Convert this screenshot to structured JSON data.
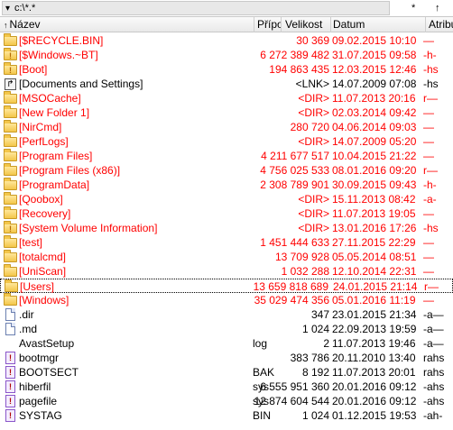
{
  "path_bar": {
    "drive_glyph": "▾",
    "path": "c:\\*.*",
    "star": "*",
    "updir": "↑"
  },
  "header": {
    "name": "Název",
    "ext": "Přípona",
    "size": "Velikost",
    "date": "Datum",
    "attr": "Atributy",
    "sort_arrow": "↑"
  },
  "colors": {
    "system": "#ff0000",
    "normal": "#000000",
    "folder": "#f3c64a"
  },
  "rows": [
    {
      "icon": "folder-icon",
      "name": "[$RECYCLE.BIN]",
      "ext": "",
      "size": "30 369",
      "date": "09.02.2015 10:10",
      "attr": "—",
      "red": true
    },
    {
      "icon": "folder-warning-icon",
      "name": "[$Windows.~BT]",
      "ext": "",
      "size": "6 272 389 482",
      "date": "31.07.2015 09:58",
      "attr": "-h-",
      "red": true
    },
    {
      "icon": "folder-warning-icon",
      "name": "[Boot]",
      "ext": "",
      "size": "194 863 435",
      "date": "12.03.2015 12:46",
      "attr": "-hs",
      "red": true
    },
    {
      "icon": "junction-icon",
      "name": "[Documents and Settings]",
      "ext": "",
      "size": "<LNK>",
      "date": "14.07.2009 07:08",
      "attr": "-hs",
      "red": false
    },
    {
      "icon": "folder-icon",
      "name": "[MSOCache]",
      "ext": "",
      "size": "<DIR>",
      "date": "11.07.2013 20:16",
      "attr": "r—",
      "red": true
    },
    {
      "icon": "folder-icon",
      "name": "[New Folder 1]",
      "ext": "",
      "size": "<DIR>",
      "date": "02.03.2014 09:42",
      "attr": "—",
      "red": true
    },
    {
      "icon": "folder-icon",
      "name": "[NirCmd]",
      "ext": "",
      "size": "280 720",
      "date": "04.06.2014 09:03",
      "attr": "—",
      "red": true
    },
    {
      "icon": "folder-icon",
      "name": "[PerfLogs]",
      "ext": "",
      "size": "<DIR>",
      "date": "14.07.2009 05:20",
      "attr": "—",
      "red": true
    },
    {
      "icon": "folder-icon",
      "name": "[Program Files]",
      "ext": "",
      "size": "4 211 677 517",
      "date": "10.04.2015 21:22",
      "attr": "—",
      "red": true
    },
    {
      "icon": "folder-icon",
      "name": "[Program Files (x86)]",
      "ext": "",
      "size": "4 756 025 533",
      "date": "08.01.2016 09:20",
      "attr": "r—",
      "red": true
    },
    {
      "icon": "folder-icon",
      "name": "[ProgramData]",
      "ext": "",
      "size": "2 308 789 901",
      "date": "30.09.2015 09:43",
      "attr": "-h-",
      "red": true
    },
    {
      "icon": "folder-icon",
      "name": "[Qoobox]",
      "ext": "",
      "size": "<DIR>",
      "date": "15.11.2013 08:42",
      "attr": "-a-",
      "red": true
    },
    {
      "icon": "folder-icon",
      "name": "[Recovery]",
      "ext": "",
      "size": "<DIR>",
      "date": "11.07.2013 19:05",
      "attr": "—",
      "red": true
    },
    {
      "icon": "folder-warning-icon",
      "name": "[System Volume Information]",
      "ext": "",
      "size": "<DIR>",
      "date": "13.01.2016 17:26",
      "attr": "-hs",
      "red": true
    },
    {
      "icon": "folder-icon",
      "name": "[test]",
      "ext": "",
      "size": "1 451 444 633",
      "date": "27.11.2015 22:29",
      "attr": "—",
      "red": true
    },
    {
      "icon": "folder-icon",
      "name": "[totalcmd]",
      "ext": "",
      "size": "13 709 928",
      "date": "05.05.2014 08:51",
      "attr": "—",
      "red": true
    },
    {
      "icon": "folder-icon",
      "name": "[UniScan]",
      "ext": "",
      "size": "1 032 288",
      "date": "12.10.2014 22:31",
      "attr": "—",
      "red": true
    },
    {
      "icon": "folder-icon",
      "name": "[Users]",
      "ext": "",
      "size": "13 659 818 689",
      "date": "24.01.2015 21:14",
      "attr": "r—",
      "red": true,
      "selected": true
    },
    {
      "icon": "folder-icon",
      "name": "[Windows]",
      "ext": "",
      "size": "35 029 474 356",
      "date": "05.01.2016 11:19",
      "attr": "—",
      "red": true
    },
    {
      "icon": "file-icon",
      "name": ".dir",
      "ext": "",
      "size": "347",
      "date": "23.01.2015 21:34",
      "attr": "-a—",
      "red": false
    },
    {
      "icon": "file-icon",
      "name": ".md",
      "ext": "",
      "size": "1 024",
      "date": "22.09.2013 19:59",
      "attr": "-a—",
      "red": false
    },
    {
      "icon": "none",
      "name": "AvastSetup",
      "ext": "log",
      "size": "2",
      "date": "11.07.2013 19:46",
      "attr": "-a—",
      "red": false
    },
    {
      "icon": "system-file-icon",
      "name": "bootmgr",
      "ext": "",
      "size": "383 786",
      "date": "20.11.2010 13:40",
      "attr": "rahs",
      "red": false
    },
    {
      "icon": "system-file-icon",
      "name": "BOOTSECT",
      "ext": "BAK",
      "size": "8 192",
      "date": "11.07.2013 20:01",
      "attr": "rahs",
      "red": false
    },
    {
      "icon": "system-file-icon",
      "name": "hiberfil",
      "ext": "sys",
      "size": "6 555 951 360",
      "date": "20.01.2016 09:12",
      "attr": "-ahs",
      "red": false
    },
    {
      "icon": "system-file-icon",
      "name": "pagefile",
      "ext": "sys",
      "size": "12 874 604 544",
      "date": "20.01.2016 09:12",
      "attr": "-ahs",
      "red": false
    },
    {
      "icon": "system-file-icon",
      "name": "SYSTAG",
      "ext": "BIN",
      "size": "1 024",
      "date": "01.12.2015 19:53",
      "attr": "-ah-",
      "red": false
    }
  ]
}
